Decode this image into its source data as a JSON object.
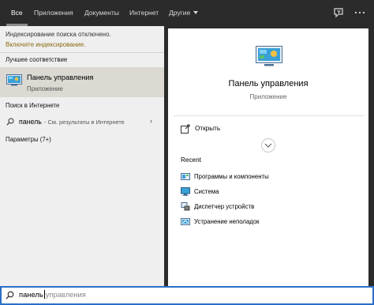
{
  "tabs": [
    {
      "label": "Все",
      "active": true
    },
    {
      "label": "Приложения",
      "active": false
    },
    {
      "label": "Документы",
      "active": false
    },
    {
      "label": "Интернет",
      "active": false
    },
    {
      "label": "Другие",
      "active": false,
      "dropdown": true
    }
  ],
  "topbar_icons": [
    "feedback-icon",
    "more-options-icon"
  ],
  "left": {
    "notice": "Индексирование поиска отключено.",
    "notice_link": "Включите индексирование.",
    "best_match_heading": "Лучшее соответствие",
    "best_match": {
      "name": "Панель управления",
      "type": "Приложение",
      "icon": "control-panel-icon"
    },
    "web_heading": "Поиск в Интернете",
    "web_result": {
      "query": "панель",
      "suffix": "- См. результаты в Интернете"
    },
    "settings_heading": "Параметры (7+)"
  },
  "preview": {
    "title": "Панель управления",
    "subtitle": "Приложение",
    "action_open": "Открыть",
    "recent_heading": "Recent",
    "recent_items": [
      {
        "label": "Программы и компоненты",
        "icon": "programs-icon"
      },
      {
        "label": "Система",
        "icon": "system-icon"
      },
      {
        "label": "Диспетчер устройств",
        "icon": "device-manager-icon"
      },
      {
        "label": "Устранение неполадок",
        "icon": "troubleshoot-icon"
      }
    ]
  },
  "search": {
    "typed": "панель",
    "suggestion": "управления"
  },
  "colors": {
    "taskbar_bg": "#2b2b2b",
    "left_bg": "#efefef",
    "selected_bg": "#dcd9d2",
    "accent": "#2a6fc9",
    "notice_link": "#8a6a10"
  }
}
